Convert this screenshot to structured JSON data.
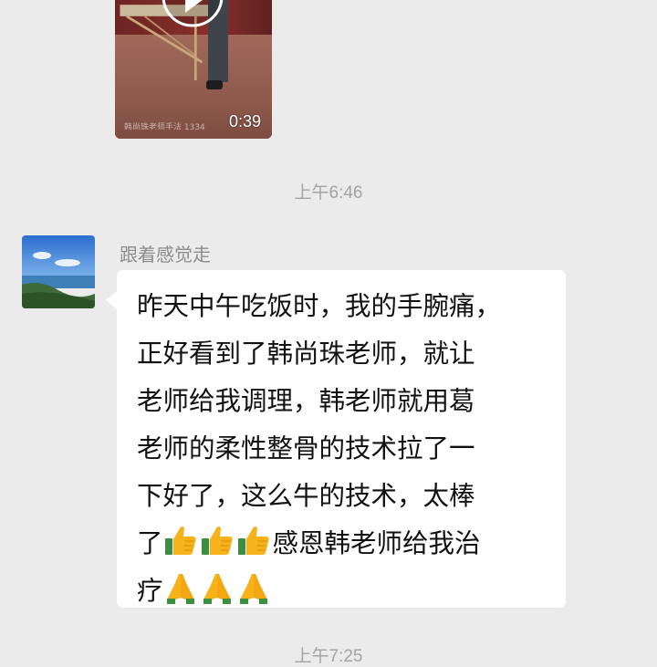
{
  "video": {
    "duration": "0:39",
    "watermark": "韩尚珠老师手法 1334"
  },
  "timestamps": {
    "first": "上午6:46",
    "second": "上午7:25"
  },
  "message": {
    "sender": "跟着感觉走",
    "lines": [
      "昨天中午吃饭时，我的手腕痛，",
      "正好看到了韩尚珠老师，就让",
      "老师给我调理，韩老师就用葛",
      "老师的柔性整骨的技术拉了一",
      "下好了，这么牛的技术，太棒"
    ],
    "line6_prefix": "了",
    "line6_suffix": "感恩韩老师给我治",
    "line7_prefix": "疗",
    "emoji_thumb": "thumbs-up-emoji",
    "emoji_pray": "folded-hands-emoji"
  },
  "colors": {
    "background": "#ebebeb",
    "bubble": "#ffffff",
    "timestamp": "#a3a3a3",
    "sender": "#8c8c8c"
  }
}
